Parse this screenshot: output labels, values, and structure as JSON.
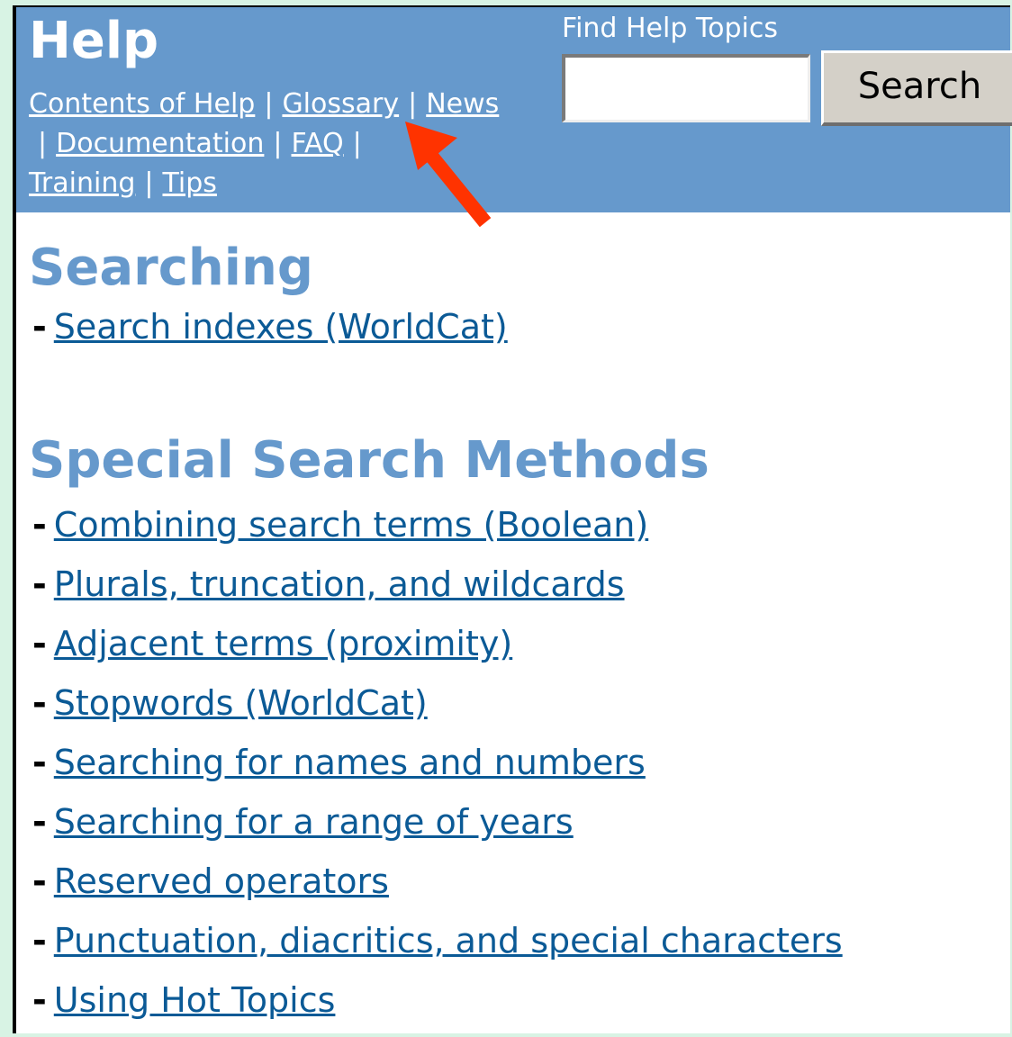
{
  "header": {
    "title": "Help",
    "nav": [
      {
        "label": "Contents of Help"
      },
      {
        "label": "Glossary"
      },
      {
        "label": "News"
      },
      {
        "label": "Documentation"
      },
      {
        "label": "FAQ"
      },
      {
        "label": "Training"
      },
      {
        "label": "Tips"
      }
    ],
    "separator": "|",
    "find_label": "Find Help Topics",
    "search_value": "",
    "search_button": "Search"
  },
  "colors": {
    "header_bg": "#6699cc",
    "heading": "#6699cc",
    "link": "#0b5a96",
    "page_bg": "#d8f3e4",
    "annotation_arrow": "#ff3300"
  },
  "sections": {
    "searching": {
      "title": "Searching",
      "links": [
        "Search indexes (WorldCat)"
      ]
    },
    "special": {
      "title": "Special Search Methods",
      "links": [
        "Combining search terms (Boolean)",
        "Plurals, truncation, and wildcards",
        "Adjacent terms (proximity)",
        "Stopwords (WorldCat)",
        "Searching for names and numbers",
        "Searching for a range of years",
        "Reserved operators",
        "Punctuation, diacritics, and special characters",
        "Using Hot Topics"
      ]
    }
  },
  "bullet": "-",
  "annotation": {
    "icon": "red-arrow-icon",
    "points_to": "Glossary"
  }
}
